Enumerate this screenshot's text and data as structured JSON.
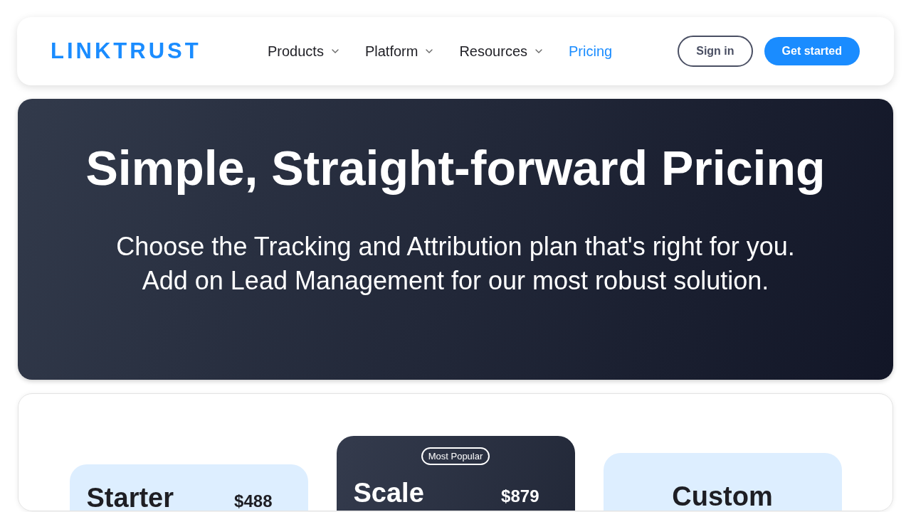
{
  "header": {
    "logo": "LINKTRUST",
    "nav": [
      {
        "label": "Products",
        "dropdown": true,
        "selected": false
      },
      {
        "label": "Platform",
        "dropdown": true,
        "selected": false
      },
      {
        "label": "Resources",
        "dropdown": true,
        "selected": false
      },
      {
        "label": "Pricing",
        "dropdown": false,
        "selected": true
      }
    ],
    "sign_in": "Sign in",
    "get_started": "Get started"
  },
  "hero": {
    "title": "Simple, Straight-forward Pricing",
    "subtitle": [
      "Choose the Tracking and Attribution plan that's right for you.",
      "Add on Lead Management for our most robust solution."
    ]
  },
  "plans": [
    {
      "kind": "standard",
      "name": "Starter",
      "price": "$488"
    },
    {
      "kind": "featured",
      "badge": "Most Popular",
      "name": "Scale",
      "price": "$879"
    },
    {
      "kind": "custom",
      "name": "Custom"
    }
  ]
}
